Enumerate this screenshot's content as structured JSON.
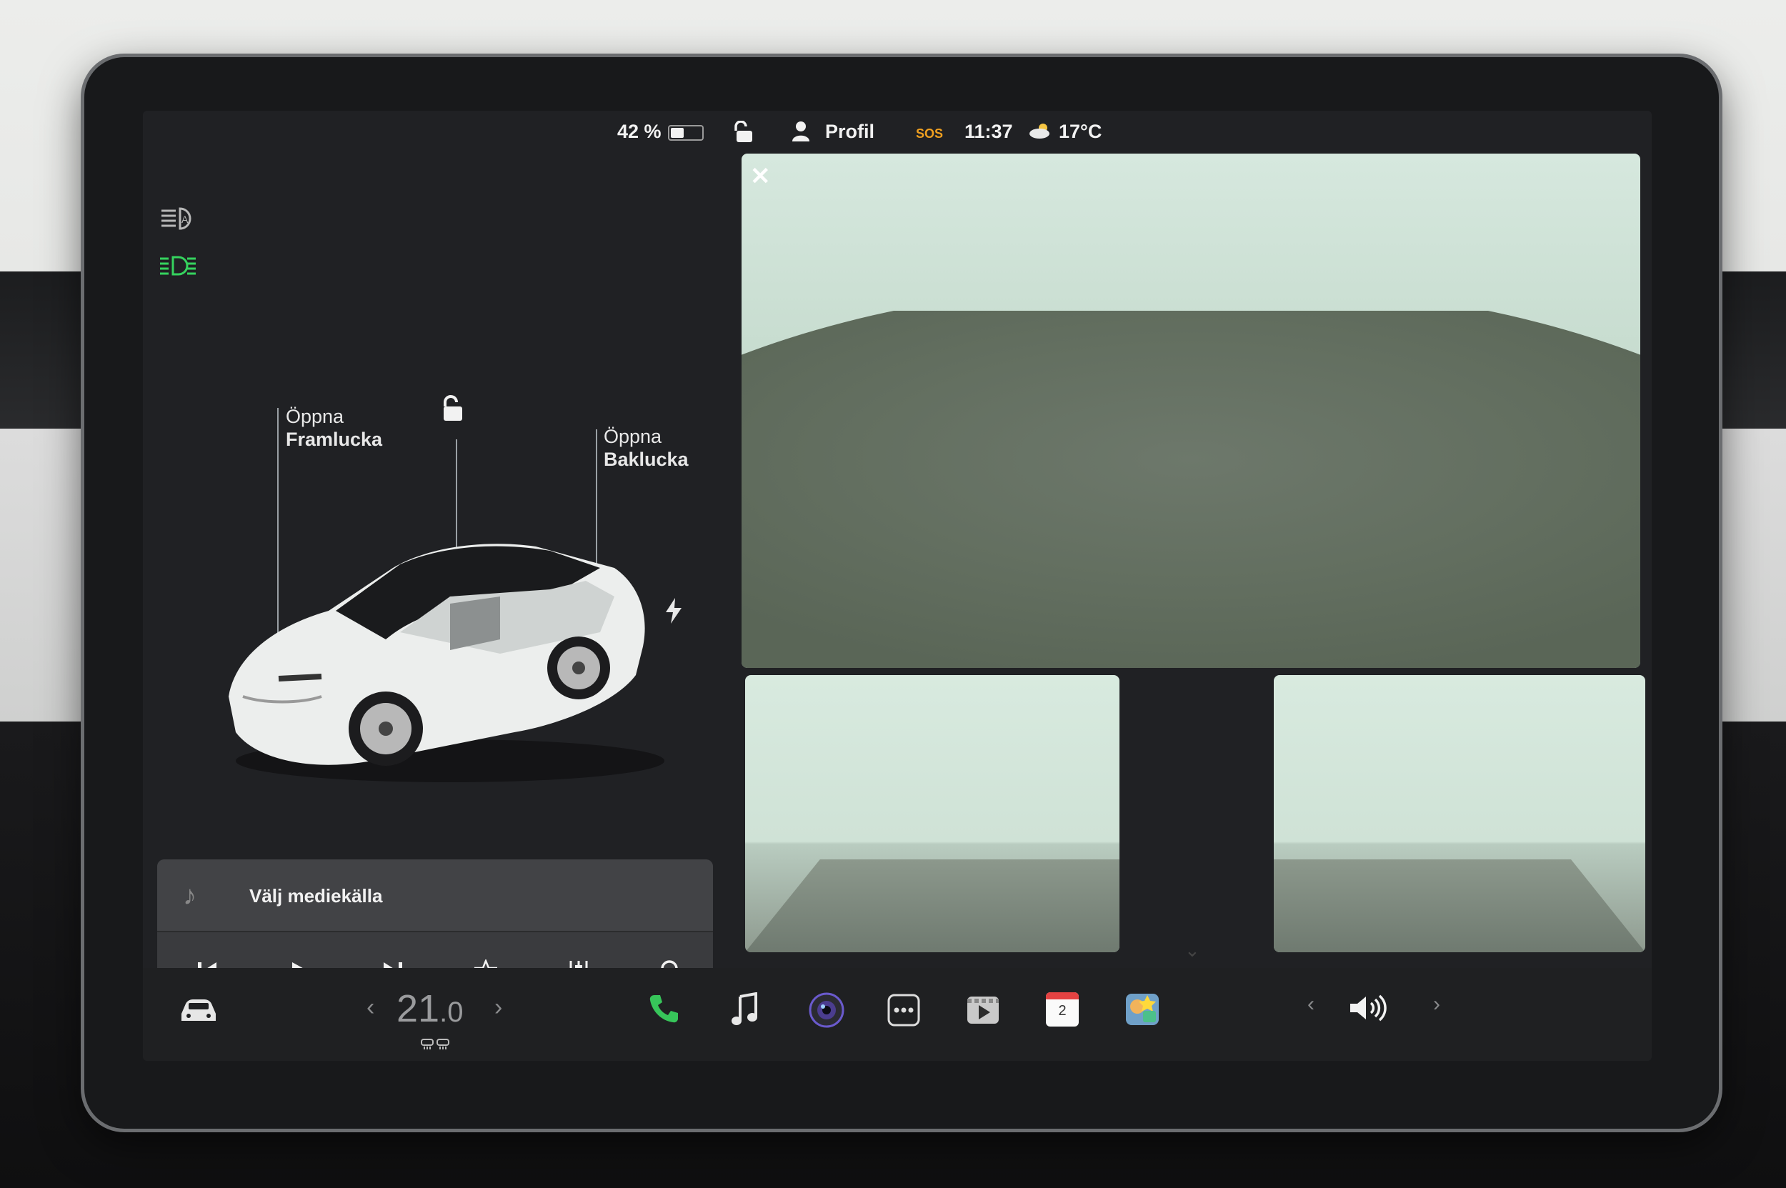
{
  "status_bar": {
    "battery_percent_label": "42 %",
    "battery_level": 0.42,
    "profile_label": "Profil",
    "sos_label": "SOS",
    "time": "11:37",
    "temperature": "17°C"
  },
  "vehicle": {
    "frunk_label_line1": "Öppna",
    "frunk_label_line2": "Framlucka",
    "trunk_label_line1": "Öppna",
    "trunk_label_line2": "Baklucka"
  },
  "media": {
    "source_label": "Välj mediekälla"
  },
  "dock": {
    "cabin_temp_main": "21",
    "cabin_temp_decimal": ".0",
    "calendar_day": "2"
  },
  "colors": {
    "headlight_green": "#35d35e",
    "phone_green": "#37c55a",
    "sos_orange": "#f0a020",
    "screen_bg": "#202124"
  }
}
